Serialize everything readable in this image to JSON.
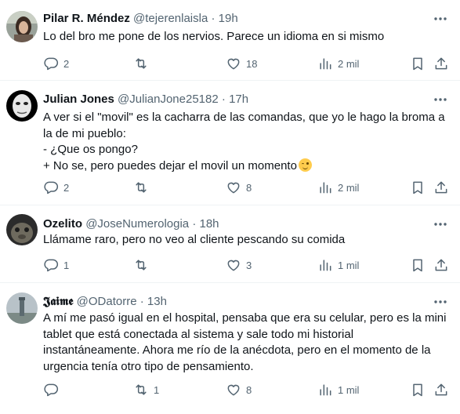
{
  "tweets": [
    {
      "name": "Pilar R. Méndez",
      "handle": "@tejerenlaisla",
      "sep": "·",
      "time": "19h",
      "text": "Lo del bro me pone de los nervios. Parece un idioma en si mismo",
      "replies": "2",
      "retweets": "",
      "likes": "18",
      "views": "2 mil",
      "avatar_icon": "woman-portrait-avatar"
    },
    {
      "name": "Julian Jones",
      "handle": "@JulianJone25182",
      "sep": "·",
      "time": "17h",
      "text": "A ver si el \"movil\" es la cacharra de las comandas, que yo le hago la broma a la de mi pueblo:\n- ¿Que os pongo?\n+ No se, pero puedes dejar el movil un momento",
      "emoji": "winking-face",
      "replies": "2",
      "retweets": "",
      "likes": "8",
      "views": "2 mil",
      "avatar_icon": "mask-avatar"
    },
    {
      "name": "Ozelito",
      "handle": "@JoseNumerologia",
      "sep": "·",
      "time": "18h",
      "text": "Llámame raro, pero no veo al cliente pescando su comida",
      "replies": "1",
      "retweets": "",
      "likes": "3",
      "views": "1 mil",
      "avatar_icon": "creature-avatar"
    },
    {
      "name": "𝕵𝖆𝖎𝖒𝖊",
      "handle": "@ODatorre",
      "sep": "·",
      "time": "13h",
      "text": "A mí me pasó igual en el hospital, pensaba que era su celular, pero es la mini tablet que está conectada al sistema y sale todo mi historial instantáneamente. Ahora me río de la anécdota, pero en el momento de la urgencia tenía otro tipo de pensamiento.",
      "replies": "",
      "retweets": "1",
      "likes": "8",
      "views": "1 mil",
      "avatar_icon": "tower-avatar"
    }
  ],
  "colors": {
    "text": "#0f1419",
    "secondary": "#536471",
    "divider": "#eff3f4"
  }
}
